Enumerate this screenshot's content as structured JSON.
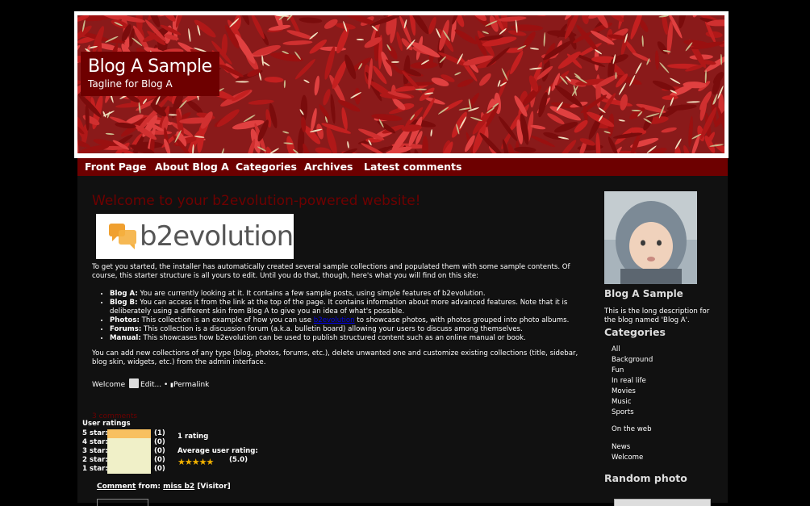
{
  "header": {
    "blog_title": "Blog A Sample",
    "tagline": "Tagline for Blog A"
  },
  "menu": [
    "Front Page",
    "About Blog A",
    "Categories",
    "Archives",
    "Latest comments"
  ],
  "post": {
    "title": "Welcome to your b2evolution-powered website!",
    "logo_text": "b2evolution",
    "intro": "To get you started, the installer has automatically created several sample collections and populated them with some sample contents. Of course, this starter structure is all yours to edit. Until you do that, though, here's what you will find on this site:",
    "bullets": [
      {
        "label": "Blog A:",
        "text": " You are currently looking at it. It contains a few sample posts, using simple features of b2evolution."
      },
      {
        "label": "Blog B:",
        "text": " You can access it from the link at the top of the page. It contains information about more advanced features. Note that it is deliberately using a different skin from Blog A to give you an idea of what's possible."
      },
      {
        "label": "Photos:",
        "text_before": " This collection is an example of how you can use ",
        "link": "b2evolution",
        "text_after": " to showcase photos, with photos grouped into photo albums."
      },
      {
        "label": "Forums:",
        "text": " This collection is a discussion forum (a.k.a. bulletin board) allowing your users to discuss among themselves."
      },
      {
        "label": "Manual:",
        "text": " This showcases how b2evolution can be used to publish structured content such as an online manual or book."
      }
    ],
    "outro": "You can add new collections of any type (blog, photos, forums, etc.), delete unwanted one and customize existing collections (title, sidebar, blog skin, widgets, etc.) from the admin interface.",
    "meta_category": "Welcome",
    "edit_label": "Edit...",
    "bullet_sep": "•",
    "permalink_label": "Permalink",
    "comments_count": "3 comments"
  },
  "ratings": {
    "heading": "User ratings",
    "rows": [
      {
        "label": "5 star:",
        "count": "(1)",
        "fraction": 1.0
      },
      {
        "label": "4 star:",
        "count": "(0)",
        "fraction": 0
      },
      {
        "label": "3 star:",
        "count": "(0)",
        "fraction": 0
      },
      {
        "label": "2 star:",
        "count": "(0)",
        "fraction": 0
      },
      {
        "label": "1 star:",
        "count": "(0)",
        "fraction": 0
      }
    ],
    "summary": "1 rating",
    "avg_label": "Average user rating:",
    "stars": "★★★★★",
    "avg_value": "(5.0)",
    "star_color": "#f0b000"
  },
  "comment": {
    "comment_label": "Comment",
    "from_label": "from:",
    "author": "miss b2",
    "visitor_label": "[Visitor]"
  },
  "sidebar": {
    "blog_name": "Blog A Sample",
    "description": "This is the long description for the blog named 'Blog A'.",
    "categories_heading": "Categories",
    "categories": [
      "All",
      "Background",
      "Fun",
      "In real life",
      "Movies",
      "Music",
      "Sports"
    ],
    "categories_web": [
      "On the web"
    ],
    "categories_extra": [
      "News",
      "Welcome"
    ],
    "random_photo_heading": "Random photo"
  },
  "colors": {
    "accent": "#6d0000",
    "background": "#000000",
    "content_bg": "#111111"
  }
}
